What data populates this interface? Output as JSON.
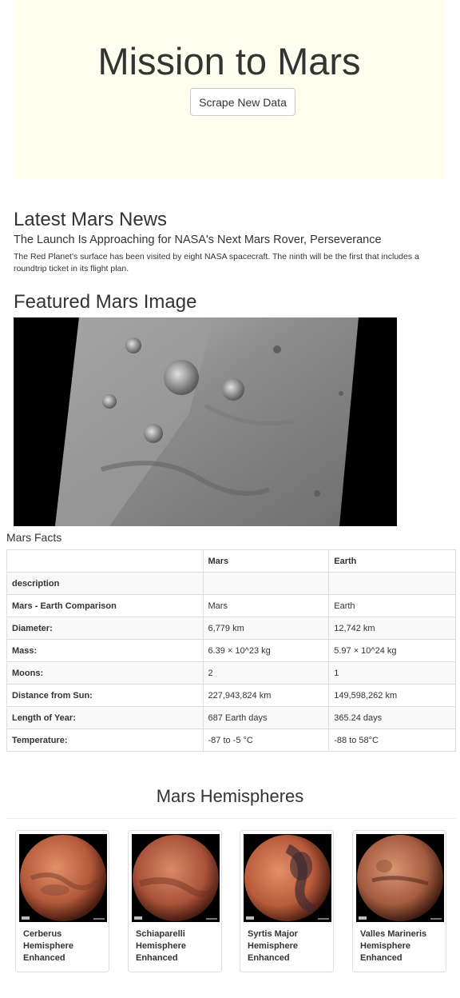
{
  "jumbotron": {
    "title": "Mission to Mars",
    "button_label": "Scrape New Data",
    "background": "#fffff0"
  },
  "news": {
    "heading": "Latest Mars News",
    "title": "The Launch Is Approaching for NASA's Next Mars Rover, Perseverance",
    "paragraph": "The Red Planet's surface has been visited by eight NASA spacecraft. The ninth will be the first that includes a roundtrip ticket in its flight plan."
  },
  "featured": {
    "heading": "Featured Mars Image"
  },
  "facts": {
    "caption": "Mars Facts",
    "headers": [
      "",
      "Mars",
      "Earth"
    ],
    "rows": [
      [
        "description",
        "",
        ""
      ],
      [
        "Mars - Earth Comparison",
        "Mars",
        "Earth"
      ],
      [
        "Diameter:",
        "6,779 km",
        "12,742 km"
      ],
      [
        "Mass:",
        "6.39 × 10^23 kg",
        "5.97 × 10^24 kg"
      ],
      [
        "Moons:",
        "2",
        "1"
      ],
      [
        "Distance from Sun:",
        "227,943,824 km",
        "149,598,262 km"
      ],
      [
        "Length of Year:",
        "687 Earth days",
        "365.24 days"
      ],
      [
        "Temperature:",
        "-87 to -5 °C",
        "-88 to 58°C"
      ]
    ]
  },
  "hemispheres": {
    "heading": "Mars Hemispheres",
    "items": [
      {
        "title": "Cerberus Hemisphere Enhanced",
        "icon": "mars-globe-image"
      },
      {
        "title": "Schiaparelli Hemisphere Enhanced",
        "icon": "mars-globe-image"
      },
      {
        "title": "Syrtis Major Hemisphere Enhanced",
        "icon": "mars-globe-image"
      },
      {
        "title": "Valles Marineris Hemisphere Enhanced",
        "icon": "mars-globe-image"
      }
    ]
  }
}
